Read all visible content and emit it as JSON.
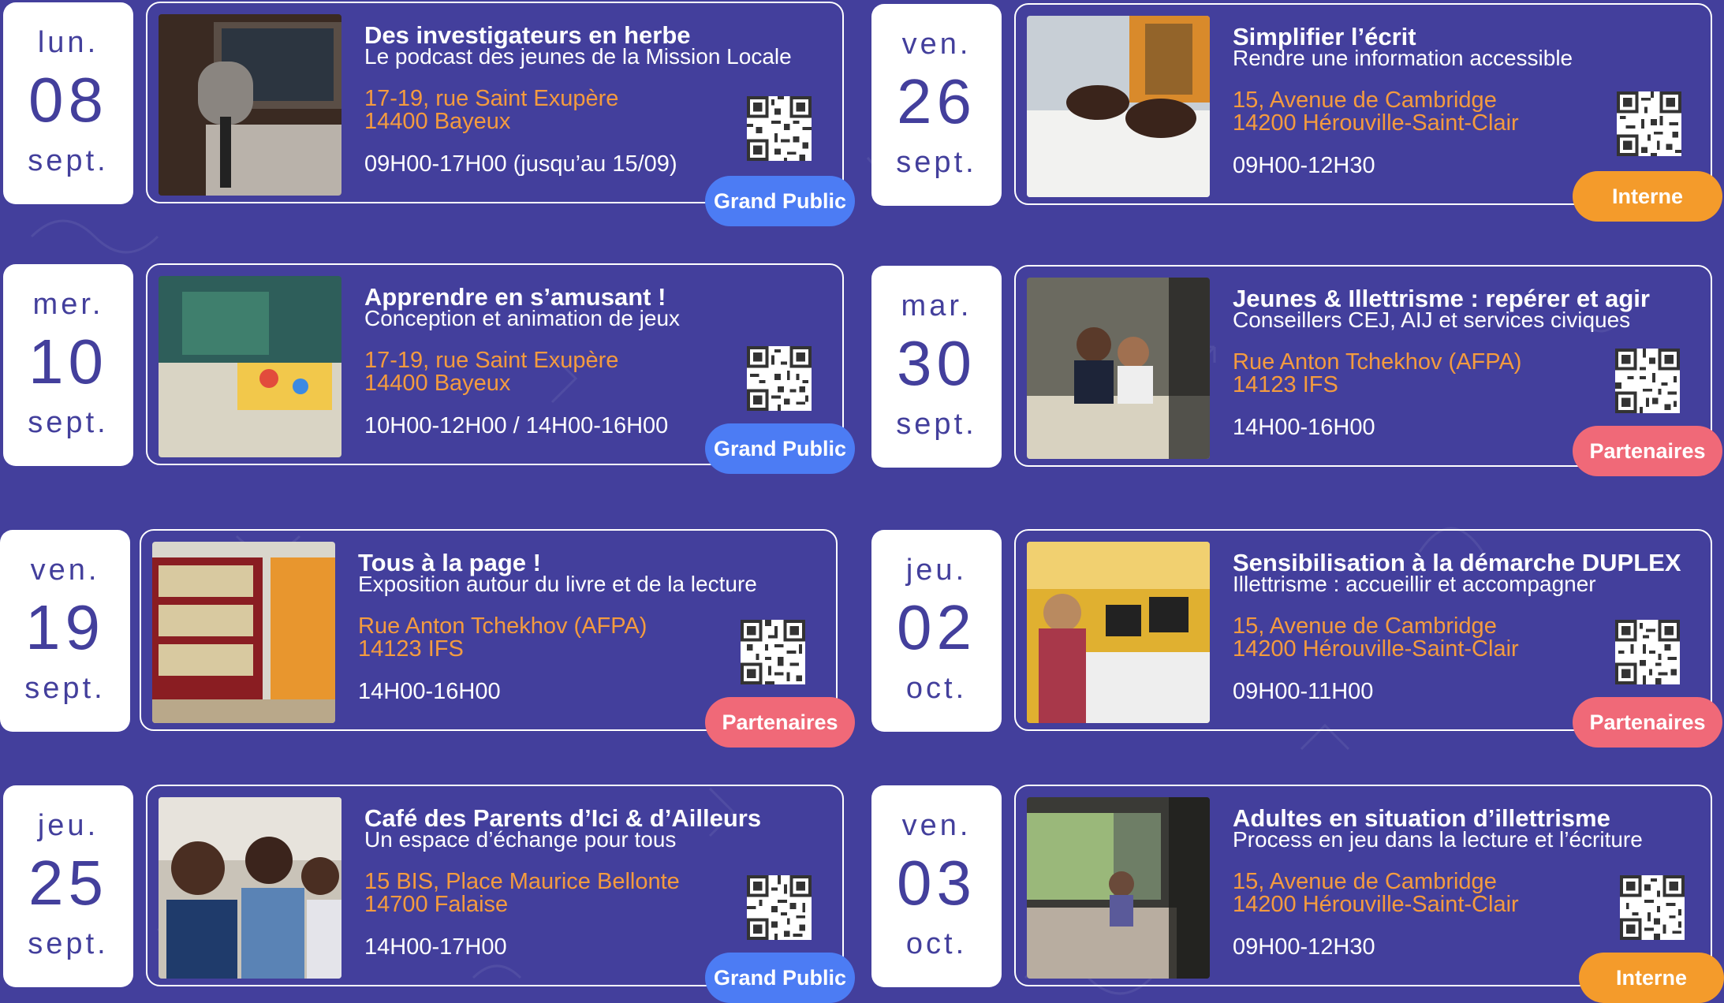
{
  "colors": {
    "background": "#433f9c",
    "accent_orange": "#f49b3f",
    "badge_grand_public": "#4c7cf4",
    "badge_interne": "#f49b2b",
    "badge_partenaires": "#f06978"
  },
  "events": [
    {
      "date": {
        "dow": "lun.",
        "day": "08",
        "month": "sept."
      },
      "title": "Des investigateurs en herbe",
      "subtitle": "Le podcast des jeunes de la Mission Locale",
      "address_line1": "17-19, rue Saint Exupère",
      "address_line2": "14400 Bayeux",
      "hours": "09H00-17H00 (jusqu’au 15/09)",
      "audience": "Grand Public",
      "photo_icon": "podcast-microphone-photo",
      "qr_icon": "qr-code-icon"
    },
    {
      "date": {
        "dow": "mer.",
        "day": "10",
        "month": "sept."
      },
      "title": "Apprendre en s’amusant !",
      "subtitle": "Conception et animation de jeux",
      "address_line1": "17-19, rue Saint Exupère",
      "address_line2": "14400 Bayeux",
      "hours": "10H00-12H00 / 14H00-16H00",
      "audience": "Grand Public",
      "photo_icon": "board-game-photo",
      "qr_icon": "qr-code-icon"
    },
    {
      "date": {
        "dow": "ven.",
        "day": "19",
        "month": "sept."
      },
      "title": "Tous à la page !",
      "subtitle": "Exposition autour du livre et de la lecture",
      "address_line1": "Rue Anton Tchekhov (AFPA)",
      "address_line2": "14123 IFS",
      "hours": "14H00-16H00",
      "audience": "Partenaires",
      "photo_icon": "library-bookshelf-photo",
      "qr_icon": "qr-code-icon"
    },
    {
      "date": {
        "dow": "jeu.",
        "day": "25",
        "month": "sept."
      },
      "title": "Café des Parents d’Ici & d’Ailleurs",
      "subtitle": "Un espace d’échange pour tous",
      "address_line1": "15 BIS, Place Maurice Bellonte",
      "address_line2": "14700 Falaise",
      "hours": "14H00-17H00",
      "audience": "Grand Public",
      "photo_icon": "group-discussion-photo",
      "qr_icon": "qr-code-icon"
    },
    {
      "date": {
        "dow": "ven.",
        "day": "26",
        "month": "sept."
      },
      "title": "Simplifier l’écrit",
      "subtitle": "Rendre une information accessible",
      "address_line1": "15, Avenue de Cambridge",
      "address_line2": "14200 Hérouville-Saint-Clair",
      "hours": "09H00-12H30",
      "audience": "Interne",
      "photo_icon": "writing-hands-photo",
      "qr_icon": "qr-code-icon"
    },
    {
      "date": {
        "dow": "mar.",
        "day": "30",
        "month": "sept."
      },
      "title": "Jeunes & Illettrisme : repérer et agir",
      "subtitle": "Conseillers CEJ, AIJ et services civiques",
      "address_line1": "Rue Anton Tchekhov (AFPA)",
      "address_line2": "14123 IFS",
      "hours": "14H00-16H00",
      "audience": "Partenaires",
      "photo_icon": "study-group-photo",
      "qr_icon": "qr-code-icon"
    },
    {
      "date": {
        "dow": "jeu.",
        "day": "02",
        "month": "oct."
      },
      "title": "Sensibilisation à la démarche DUPLEX",
      "subtitle": "Illettrisme : accueillir et accompagner",
      "address_line1": "15, Avenue de Cambridge",
      "address_line2": "14200 Hérouville-Saint-Clair",
      "hours": "09H00-11H00",
      "audience": "Partenaires",
      "photo_icon": "computer-room-photo",
      "qr_icon": "qr-code-icon"
    },
    {
      "date": {
        "dow": "ven.",
        "day": "03",
        "month": "oct."
      },
      "title": "Adultes en situation d’illettrisme",
      "subtitle": "Process en jeu dans la lecture et l’écriture",
      "address_line1": "15, Avenue de Cambridge",
      "address_line2": "14200 Hérouville-Saint-Clair",
      "hours": "09H00-12H30",
      "audience": "Interne",
      "photo_icon": "classroom-photo",
      "qr_icon": "qr-code-icon"
    }
  ]
}
